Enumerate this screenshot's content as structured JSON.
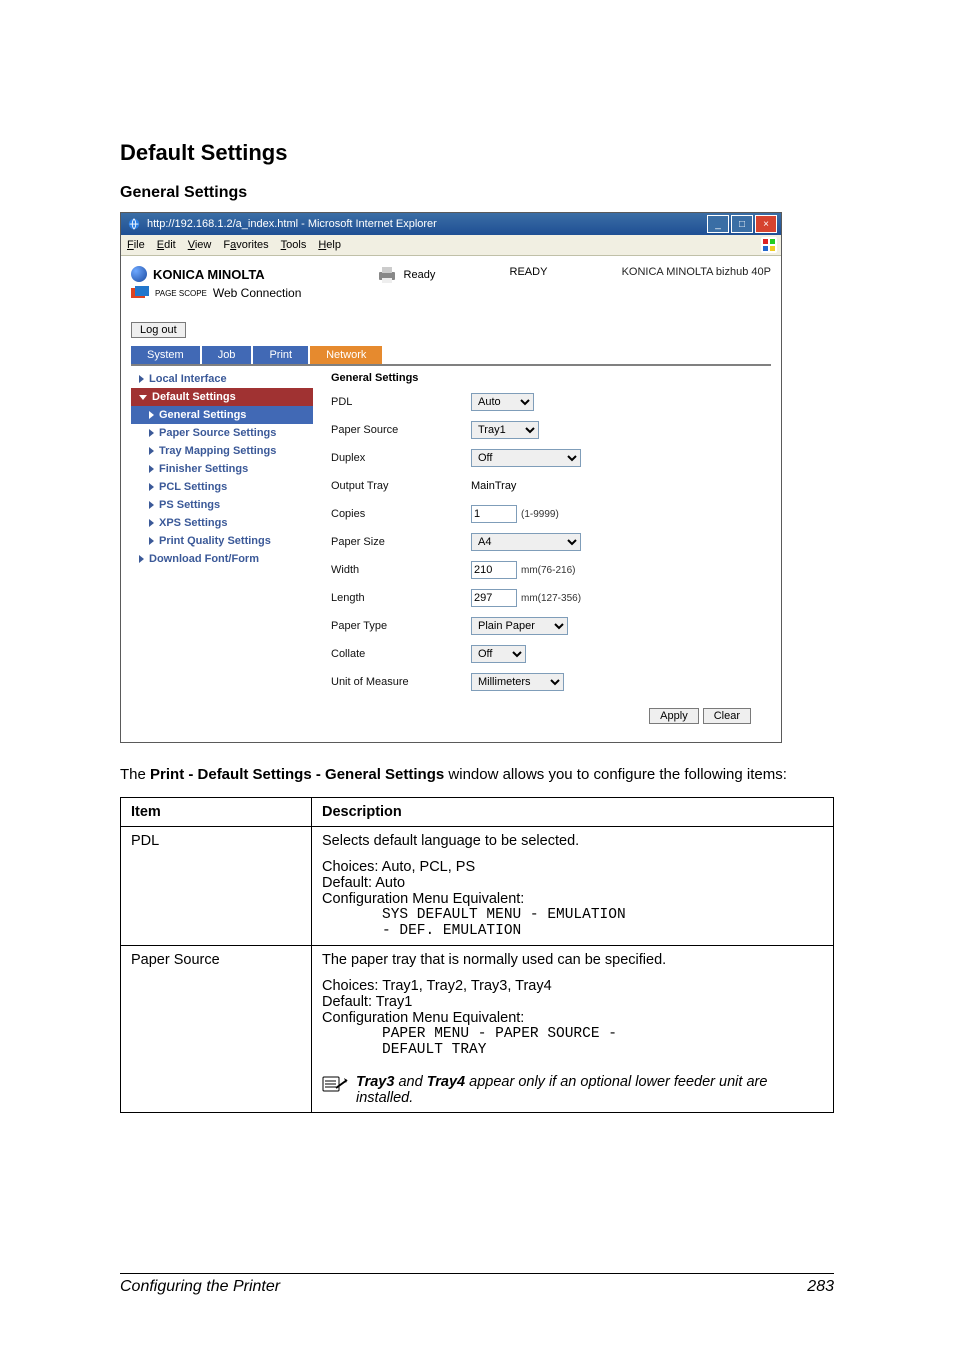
{
  "page_title": "Default Settings",
  "subsection_title": "General Settings",
  "ie_window": {
    "title": "http://192.168.1.2/a_index.html - Microsoft Internet Explorer",
    "menus": [
      "File",
      "Edit",
      "View",
      "Favorites",
      "Tools",
      "Help"
    ],
    "brand_line1": "KONICA MINOLTA",
    "brand_line2_prefix": "PAGE SCOPE",
    "brand_line2": "Web Connection",
    "status_label": "Ready",
    "status_value": "READY",
    "model": "KONICA MINOLTA bizhub 40P",
    "logout": "Log out",
    "tabs": [
      {
        "label": "System",
        "active": false
      },
      {
        "label": "Job",
        "active": false
      },
      {
        "label": "Print",
        "active": false
      },
      {
        "label": "Network",
        "active": true
      }
    ],
    "sidebar": [
      {
        "label": "Local Interface",
        "level": 1,
        "open": false,
        "selected": false
      },
      {
        "label": "Default Settings",
        "level": 1,
        "open": true,
        "selected": true
      },
      {
        "label": "General Settings",
        "level": 2,
        "open": false,
        "selected": false,
        "branch": true
      },
      {
        "label": "Paper Source Settings",
        "level": 2,
        "open": false,
        "selected": false
      },
      {
        "label": "Tray Mapping Settings",
        "level": 2,
        "open": false,
        "selected": false
      },
      {
        "label": "Finisher Settings",
        "level": 2,
        "open": false,
        "selected": false
      },
      {
        "label": "PCL Settings",
        "level": 2,
        "open": false,
        "selected": false
      },
      {
        "label": "PS Settings",
        "level": 2,
        "open": false,
        "selected": false
      },
      {
        "label": "XPS Settings",
        "level": 2,
        "open": false,
        "selected": false
      },
      {
        "label": "Print Quality Settings",
        "level": 2,
        "open": false,
        "selected": false
      },
      {
        "label": "Download Font/Form",
        "level": 1,
        "open": false,
        "selected": false
      }
    ],
    "panel_title": "General Settings",
    "fields": {
      "pdl": {
        "label": "PDL",
        "value": "Auto"
      },
      "paper_source": {
        "label": "Paper Source",
        "value": "Tray1"
      },
      "duplex": {
        "label": "Duplex",
        "value": "Off"
      },
      "output_tray": {
        "label": "Output Tray",
        "value": "MainTray"
      },
      "copies": {
        "label": "Copies",
        "value": "1",
        "range": "(1-9999)"
      },
      "paper_size": {
        "label": "Paper Size",
        "value": "A4"
      },
      "width": {
        "label": "Width",
        "value": "210",
        "range": "mm(76-216)"
      },
      "length": {
        "label": "Length",
        "value": "297",
        "range": "mm(127-356)"
      },
      "paper_type": {
        "label": "Paper Type",
        "value": "Plain Paper"
      },
      "collate": {
        "label": "Collate",
        "value": "Off"
      },
      "unit": {
        "label": "Unit of Measure",
        "value": "Millimeters"
      }
    },
    "buttons": {
      "apply": "Apply",
      "clear": "Clear"
    }
  },
  "intro_text_prefix": "The ",
  "intro_text_bold": "Print - Default Settings - General Settings",
  "intro_text_suffix": " window allows you to configure the following items:",
  "table_headers": {
    "item": "Item",
    "description": "Description"
  },
  "rows": {
    "pdl": {
      "item": "PDL",
      "desc_main": "Selects default language to be selected.",
      "choices_label": "Choices: ",
      "choices": "Auto, PCL, PS",
      "default_label": "Default:  ",
      "default": "Auto",
      "cfg_label": "Configuration Menu Equivalent:",
      "cfg_line1": "SYS DEFAULT MENU - EMULATION",
      "cfg_line2": "- DEF. EMULATION"
    },
    "paper_source": {
      "item": "Paper Source",
      "desc_main": "The paper tray that is normally used can be specified.",
      "choices_label": "Choices:  ",
      "choices": "Tray1, Tray2, Tray3, Tray4",
      "default_label": "Default: ",
      "default": "Tray1",
      "cfg_label": "Configuration Menu Equivalent:",
      "cfg_line1": "PAPER MENU - PAPER SOURCE -",
      "cfg_line2": "DEFAULT TRAY",
      "note_b1": "Tray3",
      "note_mid": " and ",
      "note_b2": "Tray4",
      "note_tail": " appear only if an optional lower feeder unit are installed."
    }
  },
  "footer": {
    "left": "Configuring the Printer",
    "right": "283"
  }
}
